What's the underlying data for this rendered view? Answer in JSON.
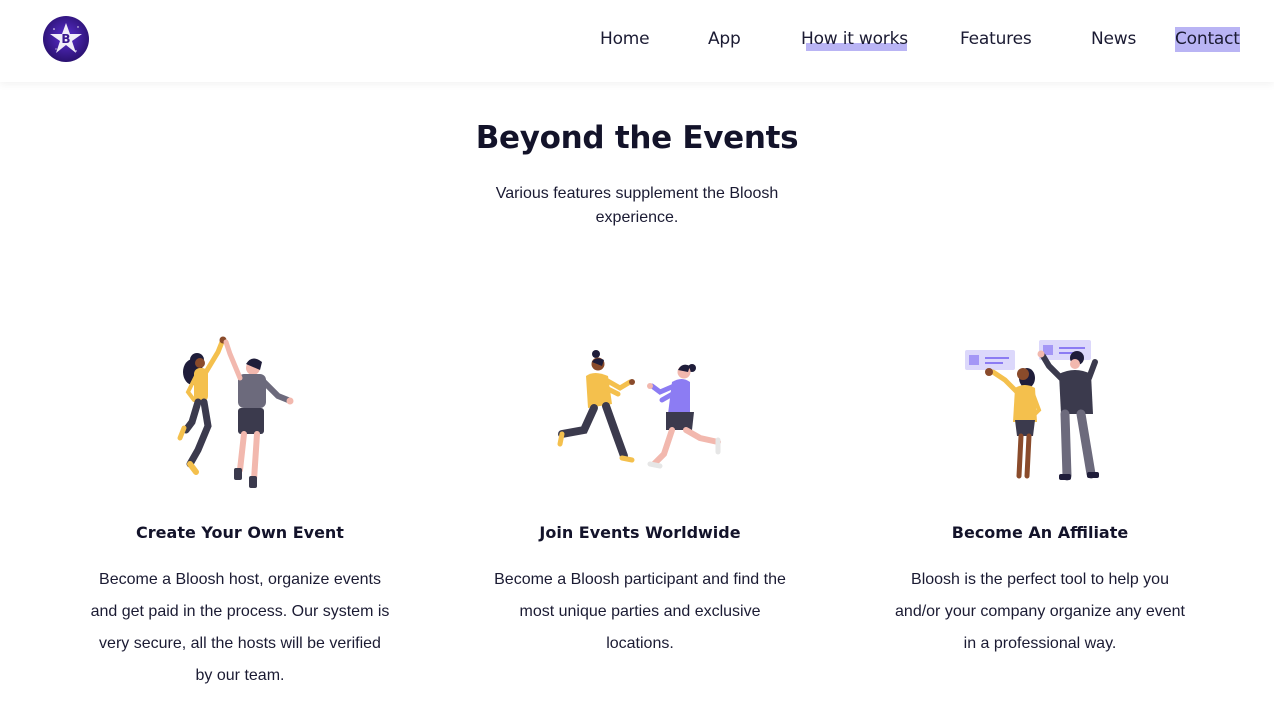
{
  "brand": {
    "logo_letter": "B",
    "logo_color": "#3b1a8f"
  },
  "nav": {
    "items": [
      "Home",
      "App",
      "How it works",
      "Features",
      "News",
      "Contact"
    ],
    "highlight_color": "#b9b4f4"
  },
  "section": {
    "title": "Beyond the Events",
    "subtitle": "Various features supplement the Bloosh experience."
  },
  "features": [
    {
      "icon": "high-five-illustration",
      "title": "Create Your Own Event",
      "text": "Become a Bloosh host, organize events and get paid in the process. Our system is very secure, all the hosts will be verified by our team."
    },
    {
      "icon": "people-meeting-illustration",
      "title": "Join Events Worldwide",
      "text": "Become a Bloosh participant and find the most unique parties and exclusive locations."
    },
    {
      "icon": "business-people-illustration",
      "title": "Become An Affiliate",
      "text": "Bloosh is the perfect tool to help you and/or your company organize any event in a professional way."
    }
  ],
  "colors": {
    "accent_purple": "#8c7cf3",
    "yellow": "#f4c04d",
    "dark": "#2f2e41"
  }
}
